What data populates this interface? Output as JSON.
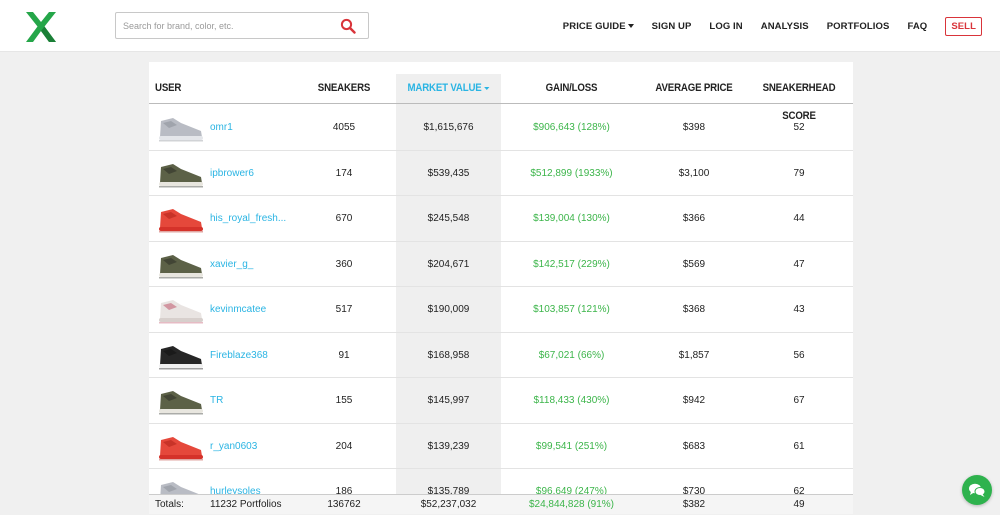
{
  "brand": {
    "logo": "stockx-x-logo",
    "accent": "#2ab4e3",
    "green": "#3cb54a",
    "sell_color": "#d9343a"
  },
  "search": {
    "placeholder": "Search for brand, color, etc.",
    "icon": "search-icon"
  },
  "nav": {
    "price_guide": "PRICE GUIDE",
    "sign_up": "SIGN UP",
    "log_in": "LOG IN",
    "analysis": "ANALYSIS",
    "portfolios": "PORTFOLIOS",
    "faq": "FAQ",
    "sell": "SELL"
  },
  "table": {
    "headers": {
      "user": "USER",
      "sneakers": "SNEAKERS",
      "market_value": "MARKET VALUE",
      "gain_loss": "GAIN/LOSS",
      "average_price": "AVERAGE PRICE",
      "score": "SNEAKERHEAD SCORE"
    },
    "rows": [
      {
        "shoe": "grey",
        "user": "omr1",
        "sneakers": "4055",
        "market_value": "$1,615,676",
        "gain": "$906,643 (128%)",
        "avg": "$398",
        "score": "52"
      },
      {
        "shoe": "olive",
        "user": "ipbrower6",
        "sneakers": "174",
        "market_value": "$539,435",
        "gain": "$512,899 (1933%)",
        "avg": "$3,100",
        "score": "79"
      },
      {
        "shoe": "red",
        "user": "his_royal_fresh...",
        "sneakers": "670",
        "market_value": "$245,548",
        "gain": "$139,004 (130%)",
        "avg": "$366",
        "score": "44"
      },
      {
        "shoe": "olive",
        "user": "xavier_g_",
        "sneakers": "360",
        "market_value": "$204,671",
        "gain": "$142,517 (229%)",
        "avg": "$569",
        "score": "47"
      },
      {
        "shoe": "white",
        "user": "kevinmcatee",
        "sneakers": "517",
        "market_value": "$190,009",
        "gain": "$103,857 (121%)",
        "avg": "$368",
        "score": "43"
      },
      {
        "shoe": "black",
        "user": "Fireblaze368",
        "sneakers": "91",
        "market_value": "$168,958",
        "gain": "$67,021 (66%)",
        "avg": "$1,857",
        "score": "56"
      },
      {
        "shoe": "olive",
        "user": "TR",
        "sneakers": "155",
        "market_value": "$145,997",
        "gain": "$118,433 (430%)",
        "avg": "$942",
        "score": "67"
      },
      {
        "shoe": "red",
        "user": "r_yan0603",
        "sneakers": "204",
        "market_value": "$139,239",
        "gain": "$99,541 (251%)",
        "avg": "$683",
        "score": "61"
      },
      {
        "shoe": "grey",
        "user": "hurleysoles",
        "sneakers": "186",
        "market_value": "$135,789",
        "gain": "$96,649 (247%)",
        "avg": "$730",
        "score": "62"
      }
    ],
    "totals": {
      "label": "Totals:",
      "portfolios": "11232 Portfolios",
      "sneakers": "136762",
      "market_value": "$52,237,032",
      "gain": "$24,844,828 (91%)",
      "avg": "$382",
      "score": "49"
    }
  },
  "chat": {
    "icon": "chat-bubbles-icon"
  }
}
